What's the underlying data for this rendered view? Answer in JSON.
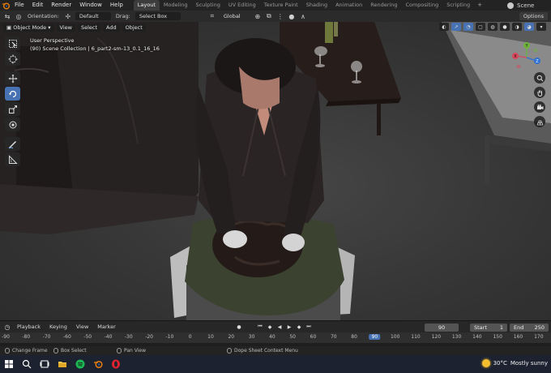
{
  "menubar": {
    "items": [
      "File",
      "Edit",
      "Render",
      "Window",
      "Help"
    ],
    "workspaces": [
      "Layout",
      "Modeling",
      "Sculpting",
      "UV Editing",
      "Texture Paint",
      "Shading",
      "Animation",
      "Rendering",
      "Compositing",
      "Scripting"
    ],
    "active_workspace": "Layout",
    "add_tab": "+",
    "scene_label": "Scene"
  },
  "tool_settings": {
    "orientation_label": "Orientation:",
    "orientation_value": "Default",
    "drag_label": "Drag:",
    "drag_value": "Select Box",
    "transform_value": "Global",
    "options_label": "Options"
  },
  "viewport": {
    "mode": "Object Mode",
    "menus": [
      "View",
      "Select",
      "Add",
      "Object"
    ],
    "overlay_line1": "User Perspective",
    "overlay_line2": "(90) Scene Collection | 6_part2-sm-13_0.1_16_16",
    "gizmo_axes": {
      "x": "X",
      "y": "Y",
      "z": "Z"
    }
  },
  "timeline": {
    "menus": [
      "Playback",
      "Keying",
      "View",
      "Marker"
    ],
    "current_frame": "90",
    "start_label": "Start",
    "start_value": "1",
    "end_label": "End",
    "end_value": "250",
    "ticks": [
      "-90",
      "-80",
      "-70",
      "-60",
      "-50",
      "-40",
      "-30",
      "-20",
      "-10",
      "0",
      "10",
      "20",
      "30",
      "40",
      "50",
      "60",
      "70",
      "80",
      "90",
      "100",
      "110",
      "120",
      "130",
      "140",
      "150",
      "160",
      "170"
    ]
  },
  "statusbar": {
    "change_frame": "Change Frame",
    "box_select": "Box Select",
    "pan_view": "Pan View",
    "context_menu": "Dope Sheet Context Menu"
  },
  "taskbar": {
    "temperature": "30°C",
    "weather": "Mostly sunny"
  },
  "colors": {
    "accent": "#4772b3",
    "viewport_bg": "#3a3a3a",
    "header_bg": "#232323"
  }
}
